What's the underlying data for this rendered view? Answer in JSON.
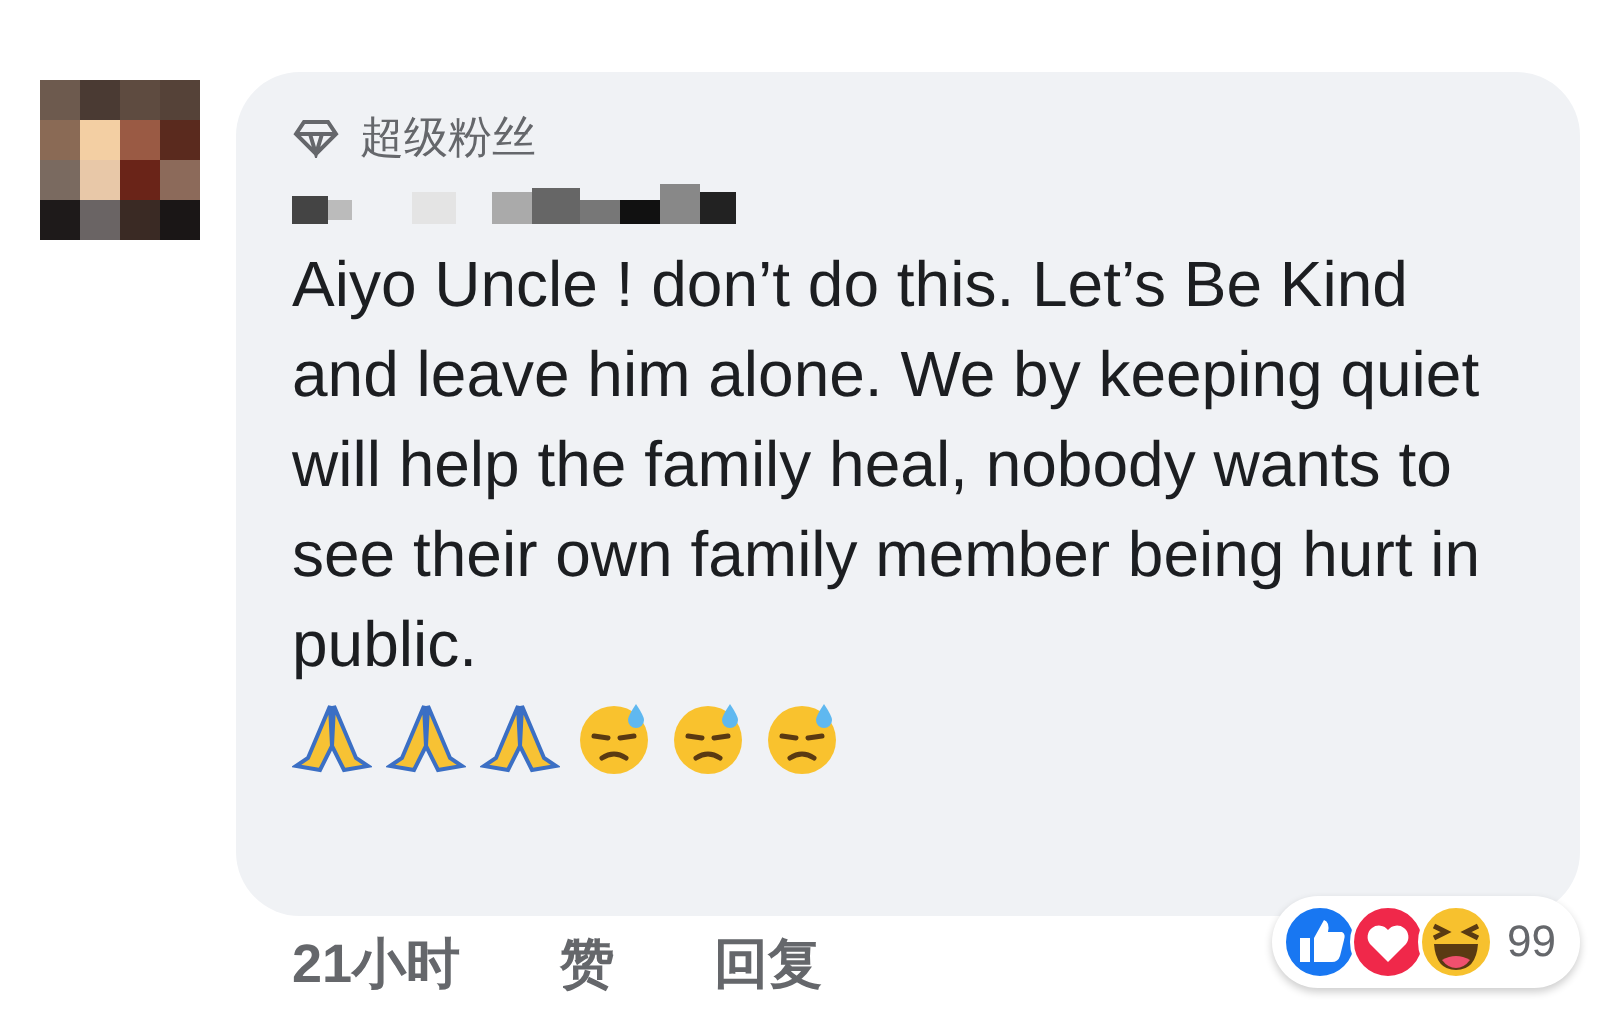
{
  "comment": {
    "badge": "超级粉丝",
    "text": "Aiyo Uncle ! don’t do this. Let’s Be Kind and leave him alone. We by keeping quiet will help the family heal, nobody wants to see their own family member being hurt in public.",
    "emojis": [
      {
        "kind": "pray"
      },
      {
        "kind": "pray"
      },
      {
        "kind": "pray"
      },
      {
        "kind": "sweat"
      },
      {
        "kind": "sweat"
      },
      {
        "kind": "sweat"
      }
    ]
  },
  "actions": {
    "time": "21小时",
    "like": "赞",
    "reply": "回复"
  },
  "reactions": {
    "types": [
      {
        "kind": "like"
      },
      {
        "kind": "love"
      },
      {
        "kind": "haha"
      }
    ],
    "count": "99"
  }
}
